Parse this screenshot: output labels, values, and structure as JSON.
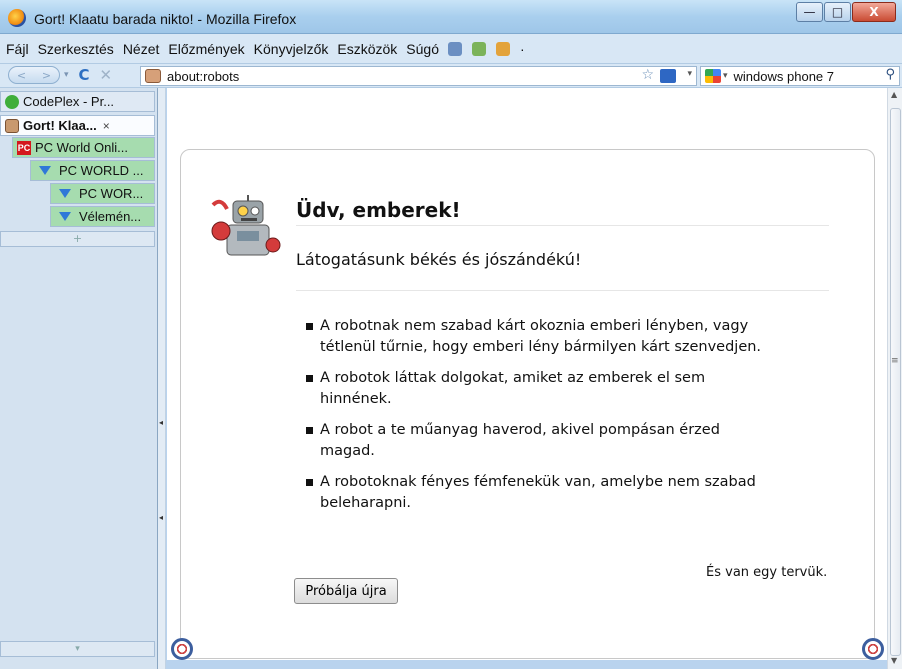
{
  "window": {
    "title": "Gort! Klaatu barada nikto! - Mozilla Firefox",
    "controls": {
      "minimize": "—",
      "maximize": "□",
      "close": "X"
    }
  },
  "menubar": {
    "items": [
      "Fájl",
      "Szerkesztés",
      "Nézet",
      "Előzmények",
      "Könyvjelzők",
      "Eszközök",
      "Súgó"
    ],
    "overflow": "·"
  },
  "navbar": {
    "back": "<",
    "forward": ">",
    "dropdown": "▾",
    "reload": "C",
    "stop": "✕",
    "url": "about:robots",
    "star": "☆",
    "search_value": "windows phone 7",
    "search_icon": "⚲"
  },
  "sidebar": {
    "tabs": [
      {
        "label": "CodePlex - Pr...",
        "icon": "codeplex-icon"
      },
      {
        "label": "Gort! Klaa...",
        "icon": "robot-icon",
        "active": true,
        "close": "×"
      },
      {
        "label": "PC World Onli...",
        "icon": "pcworld-icon"
      },
      {
        "label": "PC WORLD ...",
        "icon": "triangle-icon"
      },
      {
        "label": "PC WOR...",
        "icon": "triangle-icon"
      },
      {
        "label": "Vélemén...",
        "icon": "triangle-icon"
      }
    ],
    "new_tab": "+",
    "bottom": "▾"
  },
  "page": {
    "heading": "Üdv, emberek!",
    "subtitle": "Látogatásunk békés és jószándékú!",
    "laws": [
      "A robotnak nem szabad kárt okoznia emberi lényben, vagy tétlenül tűrnie, hogy emberi lény bármilyen kárt szenvedjen.",
      "A robotok láttak dolgokat, amiket az emberek el sem hinnének.",
      "A robot a te műanyag haverod, akivel pompásan érzed magad.",
      "A robotoknak fényes fémfenekük van, amelybe nem szabad beleharapni."
    ],
    "plan": "És van egy tervük.",
    "try_again": "Próbálja újra"
  }
}
